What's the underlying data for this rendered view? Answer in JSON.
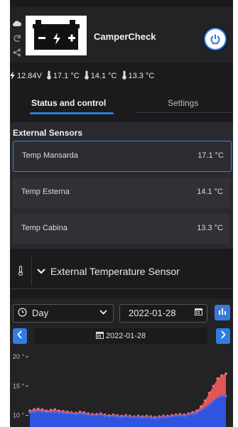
{
  "header": {
    "title": "CamperCheck",
    "side_icons": [
      "cloud-icon",
      "refresh-icon",
      "share-icon"
    ],
    "power_icon": "power-icon"
  },
  "status": {
    "voltage": "12.84V",
    "temp1": "17.1 °C",
    "temp2": "14.1 °C",
    "temp3": "13.3 °C"
  },
  "tabs": {
    "active": "Status and control",
    "inactive": "Settings"
  },
  "sensors": {
    "title": "External Sensors",
    "items": [
      {
        "name": "Temp Mansarda",
        "value": "17.1 °C"
      },
      {
        "name": "Temp Esterna",
        "value": "14.1 °C"
      },
      {
        "name": "Temp Cabina",
        "value": "13.3 °C"
      }
    ]
  },
  "selector": {
    "label": "External Temperature Sensor"
  },
  "controls": {
    "period": "Day",
    "date": "2022-01-28",
    "nav_date": "2022-01-28"
  },
  "chart_data": {
    "type": "area",
    "y_ticks": [
      "20 °",
      "15 °",
      "10 °"
    ],
    "ylim": [
      8,
      21
    ],
    "series": [
      {
        "color": "#e05555",
        "values": [
          10.8,
          11.0,
          11.1,
          11.0,
          10.8,
          10.9,
          11.0,
          10.8,
          10.7,
          10.6,
          10.5,
          10.4,
          10.6,
          10.5,
          10.3,
          10.2,
          10.2,
          10.3,
          10.1,
          10.0,
          10.1,
          10.0,
          9.9,
          10.0,
          9.9,
          9.8,
          9.9,
          9.8,
          9.9,
          9.8,
          9.7,
          9.8,
          9.9,
          9.9,
          10.0,
          10.1,
          10.2,
          10.1,
          10.3,
          10.5,
          10.8,
          11.5,
          12.5,
          13.8,
          15.0,
          16.3,
          16.8,
          17.1
        ]
      },
      {
        "color": "#2f55e0",
        "values": [
          10.5,
          10.6,
          10.7,
          10.6,
          10.5,
          10.5,
          10.6,
          10.5,
          10.4,
          10.3,
          10.3,
          10.2,
          10.3,
          10.2,
          10.1,
          10.0,
          10.0,
          10.1,
          9.9,
          9.8,
          9.9,
          9.8,
          9.7,
          9.8,
          9.7,
          9.7,
          9.7,
          9.6,
          9.7,
          9.6,
          9.5,
          9.6,
          9.7,
          9.7,
          9.8,
          9.9,
          10.0,
          9.9,
          10.1,
          10.2,
          10.4,
          10.8,
          11.3,
          11.8,
          12.4,
          13.0,
          13.3,
          13.3
        ]
      }
    ]
  }
}
